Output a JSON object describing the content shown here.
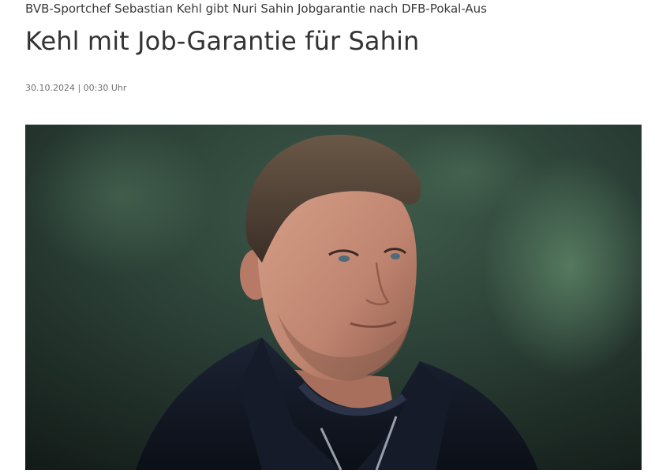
{
  "article": {
    "kicker": "BVB-Sportchef Sebastian Kehl gibt Nuri Sahin Jobgarantie nach DFB-Pokal-Aus",
    "headline": "Kehl mit Job-Garantie für Sahin",
    "dateline": "30.10.2024 | 00:30 Uhr"
  },
  "hero_image": {
    "subject": "portrait-photo-man-in-dark-jacket",
    "colors": {
      "background": "#1f2e29",
      "background_light": "#3e5a49",
      "skin": "#c8917b",
      "hair": "#5b4a3a",
      "jacket": "#141a26"
    }
  }
}
